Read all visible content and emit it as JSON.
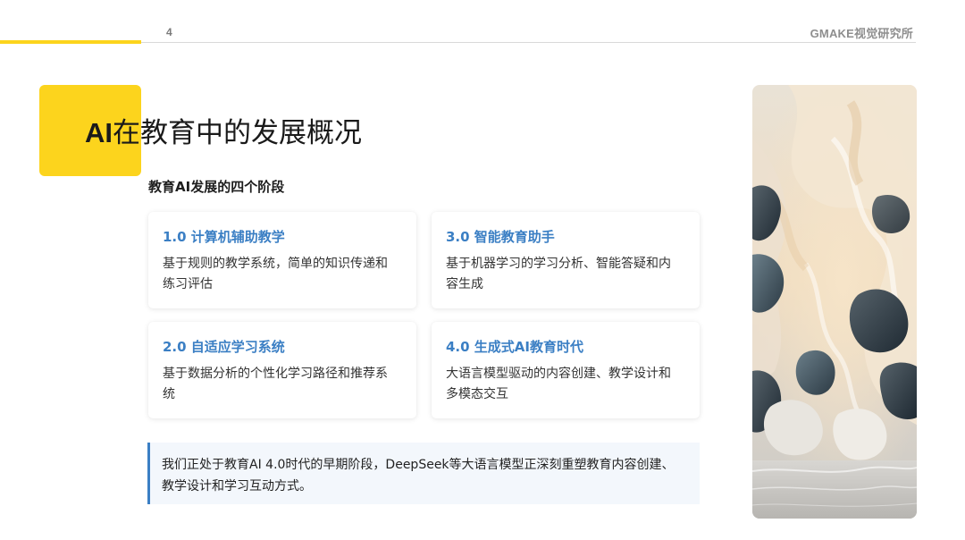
{
  "header": {
    "page_number": "4",
    "brand": "GMAKE视觉研究所"
  },
  "title": {
    "latin": "AI",
    "rest": "在教育中的发展概况"
  },
  "subtitle": "教育AI发展的四个阶段",
  "cards": [
    {
      "title": "1.0 计算机辅助教学",
      "desc_line1": "基于规则的教学系统，简单的知识传递和",
      "desc_line2": "练习评估"
    },
    {
      "title": "3.0 智能教育助手",
      "desc_line1": "基于机器学习的学习分析、智能答疑和内",
      "desc_line2": "容生成"
    },
    {
      "title": "2.0 自适应学习系统",
      "desc_line1": "基于数据分析的个性化学习路径和推荐系",
      "desc_line2": "统"
    },
    {
      "title": "4.0 生成式AI教育时代",
      "desc_line1": "大语言模型驱动的内容创建、教学设计和",
      "desc_line2": "多模态交互"
    }
  ],
  "note": {
    "line1": "我们正处于教育AI 4.0时代的早期阶段，DeepSeek等大语言模型正深刻重塑教育内容创建、",
    "line2": "教学设计和学习互动方式。"
  },
  "colors": {
    "accent_yellow": "#fcd41d",
    "accent_blue": "#3b7fc4"
  }
}
